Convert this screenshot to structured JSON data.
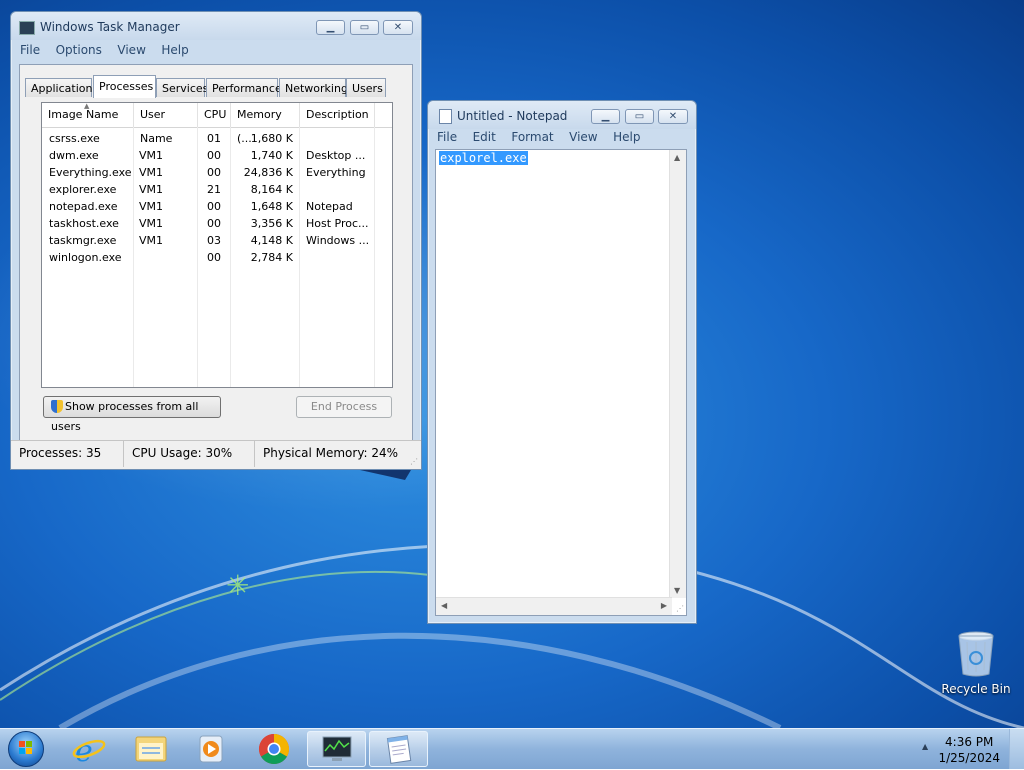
{
  "taskmgr": {
    "title": "Windows Task Manager",
    "menu": [
      "File",
      "Options",
      "View",
      "Help"
    ],
    "tabs": [
      "Applications",
      "Processes",
      "Services",
      "Performance",
      "Networking",
      "Users"
    ],
    "active_tab": "Processes",
    "columns": [
      "Image Name",
      "User Name",
      "CPU",
      "Memory (...",
      "Description"
    ],
    "rows": [
      {
        "name": "csrss.exe",
        "user": "",
        "cpu": "01",
        "mem": "1,680 K",
        "desc": ""
      },
      {
        "name": "dwm.exe",
        "user": "VM1",
        "cpu": "00",
        "mem": "1,740 K",
        "desc": "Desktop ..."
      },
      {
        "name": "Everything.exe",
        "user": "VM1",
        "cpu": "00",
        "mem": "24,836 K",
        "desc": "Everything"
      },
      {
        "name": "explorer.exe",
        "user": "VM1",
        "cpu": "21",
        "mem": "8,164 K",
        "desc": ""
      },
      {
        "name": "notepad.exe",
        "user": "VM1",
        "cpu": "00",
        "mem": "1,648 K",
        "desc": "Notepad"
      },
      {
        "name": "taskhost.exe",
        "user": "VM1",
        "cpu": "00",
        "mem": "3,356 K",
        "desc": "Host Proc..."
      },
      {
        "name": "taskmgr.exe",
        "user": "VM1",
        "cpu": "03",
        "mem": "4,148 K",
        "desc": "Windows ..."
      },
      {
        "name": "winlogon.exe",
        "user": "",
        "cpu": "00",
        "mem": "2,784 K",
        "desc": ""
      }
    ],
    "show_all_label": "Show processes from all users",
    "end_process_label": "End Process",
    "status": {
      "processes": "Processes: 35",
      "cpu": "CPU Usage: 30%",
      "memory": "Physical Memory: 24%"
    }
  },
  "notepad": {
    "title": "Untitled - Notepad",
    "menu": [
      "File",
      "Edit",
      "Format",
      "View",
      "Help"
    ],
    "content": "explorel.exe"
  },
  "desktop": {
    "recycle_bin_label": "Recycle Bin"
  },
  "taskbar": {
    "apps": [
      "start-orb-icon",
      "internet-explorer-icon",
      "file-explorer-icon",
      "media-player-icon",
      "chrome-icon",
      "task-manager-icon",
      "notepad-icon"
    ],
    "time": "4:36 PM",
    "date": "1/25/2024"
  },
  "colors": {
    "selection": "#3399ff",
    "desktop_blue": "#1768c8"
  }
}
